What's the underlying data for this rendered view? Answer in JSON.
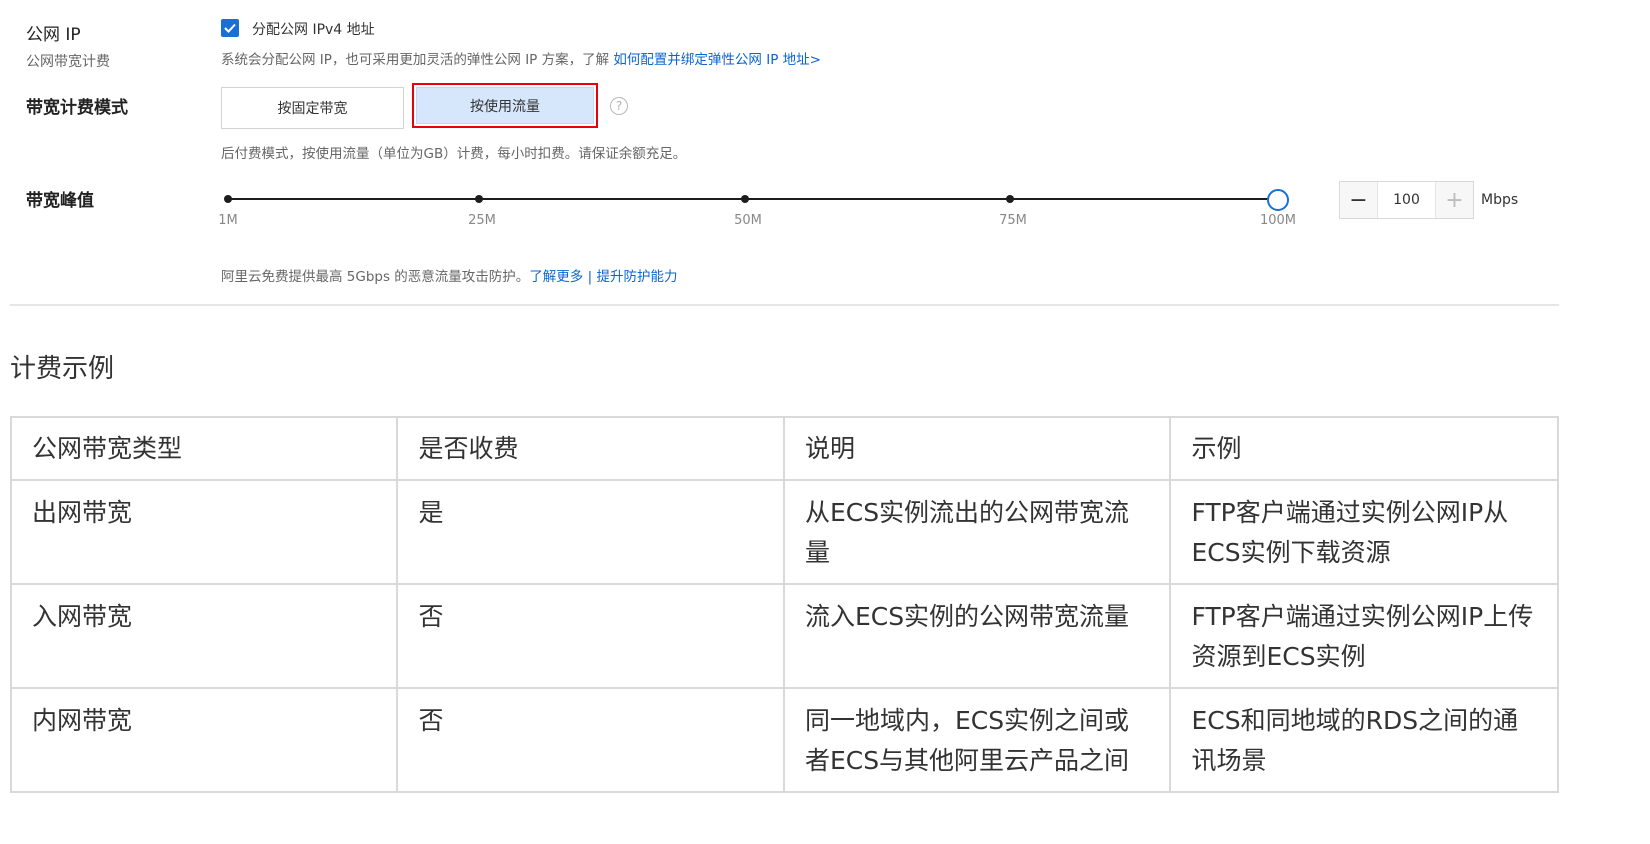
{
  "public_ip": {
    "label": "公网 IP",
    "sub_label": "公网带宽计费",
    "checkbox_label": "分配公网 IPv4 地址",
    "checked": true,
    "description": "系统会分配公网 IP，也可采用更加灵活的弹性公网 IP 方案，了解 ",
    "description_link": "如何配置并绑定弹性公网 IP 地址>"
  },
  "billing_mode": {
    "label": "带宽计费模式",
    "options": [
      "按固定带宽",
      "按使用流量"
    ],
    "selected": "按使用流量",
    "help_icon": "question-circle-icon",
    "description": "后付费模式，按使用流量（单位为GB）计费，每小时扣费。请保证余额充足。"
  },
  "bandwidth_peak": {
    "label": "带宽峰值",
    "ticks": [
      "1M",
      "25M",
      "50M",
      "75M",
      "100M"
    ],
    "value": "100",
    "value_fraction": 1.0,
    "minus": "−",
    "plus": "+",
    "unit": "Mbps",
    "protection_text": "阿里云免费提供最高 5Gbps 的恶意流量攻击防护。",
    "learn_more": "了解更多",
    "separator": "|",
    "upgrade": "提升防护能力"
  },
  "example_section": {
    "title": "计费示例",
    "headers": [
      "公网带宽类型",
      "是否收费",
      "说明",
      "示例"
    ],
    "rows": [
      [
        "出网带宽",
        "是",
        "从ECS实例流出的公网带宽流量",
        "FTP客户端通过实例公网IP从ECS实例下载资源"
      ],
      [
        "入网带宽",
        "否",
        "流入ECS实例的公网带宽流量",
        "FTP客户端通过实例公网IP上传资源到ECS实例"
      ],
      [
        "内网带宽",
        "否",
        "同一地域内，ECS实例之间或者ECS与其他阿里云产品之间",
        "ECS和同地域的RDS之间的通讯场景"
      ]
    ]
  },
  "colors": {
    "accent": "#1a6fd6",
    "link": "#0a66d1",
    "highlight": "#e8000d",
    "selected_bg": "#d6e6fb"
  }
}
